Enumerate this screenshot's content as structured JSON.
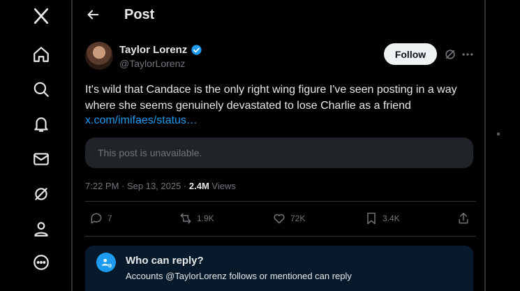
{
  "nav": {
    "items": [
      {
        "icon": "x-logo-icon"
      },
      {
        "icon": "home-icon"
      },
      {
        "icon": "search-icon"
      },
      {
        "icon": "notifications-icon"
      },
      {
        "icon": "messages-icon"
      },
      {
        "icon": "grok-icon"
      },
      {
        "icon": "profile-icon"
      },
      {
        "icon": "more-icon"
      }
    ]
  },
  "header": {
    "title": "Post"
  },
  "post": {
    "author_name": "Taylor Lorenz",
    "author_handle": "@TaylorLorenz",
    "follow_label": "Follow",
    "text": "It's wild that Candace is the only right wing figure I've seen posting in a way where she seems genuinely devastated to lose Charlie as a friend",
    "link": "x.com/imifaes/status…",
    "quoted_unavailable": "This post is unavailable.",
    "time": "7:22 PM · Sep 13, 2025 · ",
    "views_count": "2.4M",
    "views_label": " Views",
    "actions": {
      "replies": "7",
      "reposts": "1.9K",
      "likes": "72K",
      "bookmarks": "3.4K"
    },
    "colors": {
      "accent": "#1d9bf0",
      "verified": "#1d9bf0"
    }
  },
  "reply_restriction": {
    "title": "Who can reply?",
    "subtitle": "Accounts @TaylorLorenz follows or mentioned can reply"
  }
}
